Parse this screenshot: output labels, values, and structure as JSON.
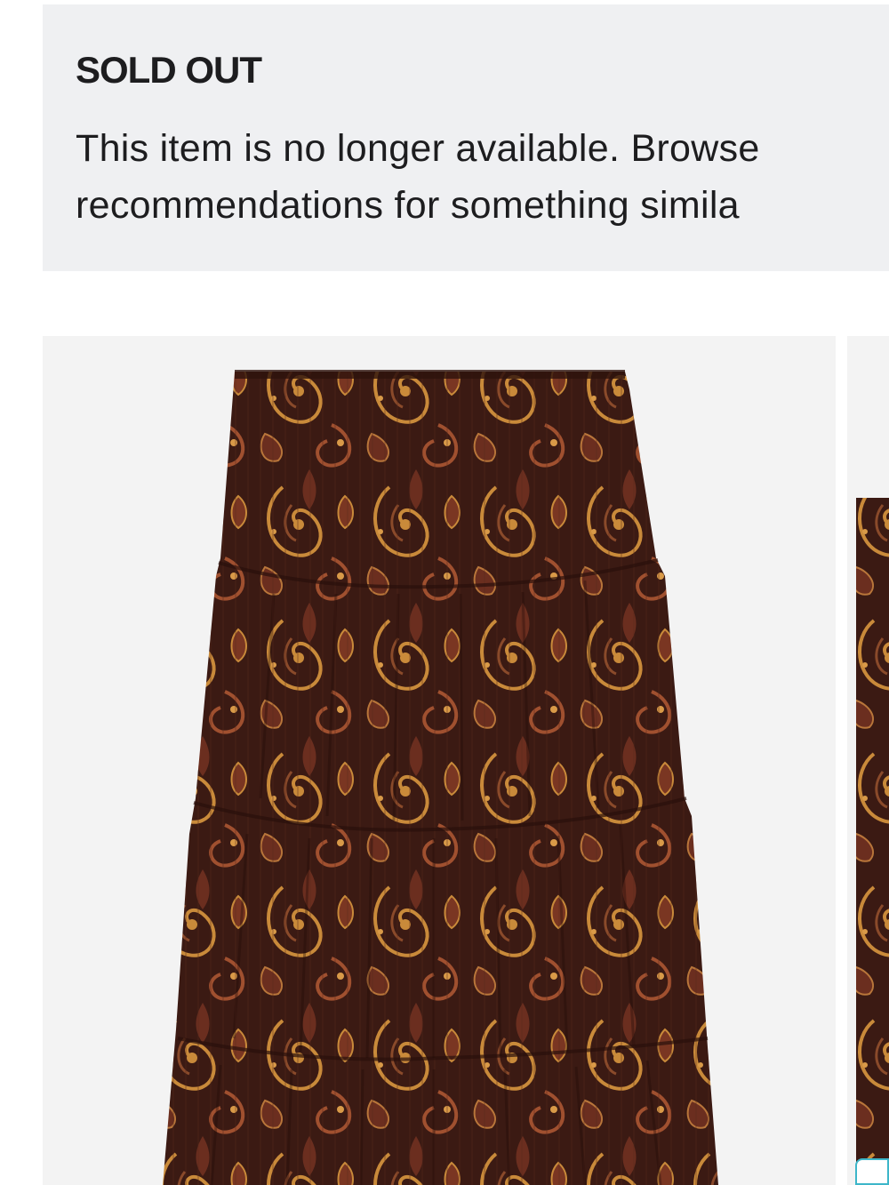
{
  "notice": {
    "title": "SOLD OUT",
    "body_line1": "This item is no longer available. Browse",
    "body_line2": "recommendations for something simila"
  },
  "product": {
    "image_alt": "Brown paisley print tiered maxi skirt",
    "colors": {
      "base": "#3b1a13",
      "mid": "#6b2e1f",
      "accent": "#c98a3a",
      "card_bg": "#f3f3f3"
    }
  },
  "colors": {
    "notice_bg": "#eff0f2",
    "text": "#1d1d1f",
    "focus": "#3db6c9"
  }
}
